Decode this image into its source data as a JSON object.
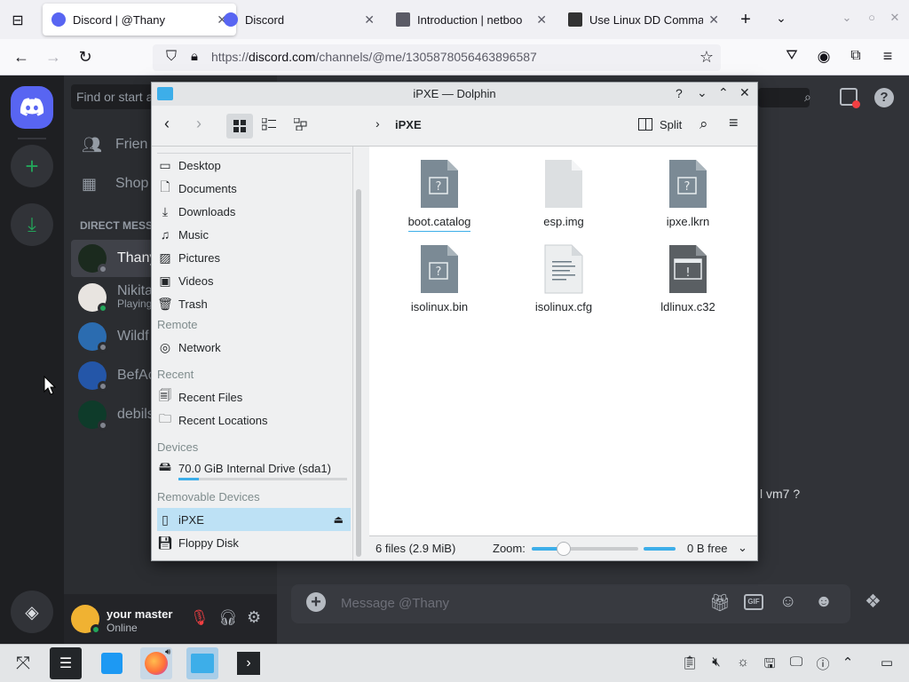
{
  "browser": {
    "tabs": [
      {
        "title": "Discord | @Thany",
        "active": true
      },
      {
        "title": "Discord",
        "active": false
      },
      {
        "title": "Introduction | netboo",
        "active": false
      },
      {
        "title": "Use Linux DD Comma",
        "active": false
      }
    ],
    "url_prefix": "https://",
    "url_domain": "discord.com",
    "url_path": "/channels/@me/1305878056463896587"
  },
  "discord": {
    "search_placeholder": "Find or start a",
    "nav": [
      {
        "label": "Frien",
        "icon": "friends-icon"
      },
      {
        "label": "Shop",
        "icon": "shop-icon"
      }
    ],
    "dm_header": "DIRECT MESS",
    "dms": [
      {
        "name": "Thany",
        "sub": "",
        "selected": true,
        "avatar_color": "#1b2a1e",
        "status": "offline"
      },
      {
        "name": "Nikita",
        "sub": "Playing",
        "selected": false,
        "avatar_color": "#e8e4e0",
        "status": "online"
      },
      {
        "name": "Wildf",
        "sub": "",
        "selected": false,
        "avatar_color": "#2b6cb0",
        "status": "offline"
      },
      {
        "name": "BefAc",
        "sub": "",
        "selected": false,
        "avatar_color": "#2456a8",
        "status": "offline"
      },
      {
        "name": "debils",
        "sub": "",
        "selected": false,
        "avatar_color": "#0e3b2a",
        "status": "offline"
      }
    ],
    "user": {
      "name": "your master",
      "status": "Online"
    },
    "message_placeholder": "Message @Thany",
    "chat_fragment": "l vm7 ?"
  },
  "dolphin": {
    "title": "iPXE — Dolphin",
    "breadcrumb": "iPXE",
    "split_label": "Split",
    "places": {
      "items_top": [
        "Desktop",
        "Documents",
        "Downloads",
        "Music",
        "Pictures",
        "Videos",
        "Trash"
      ],
      "remote_header": "Remote",
      "remote_items": [
        "Network"
      ],
      "recent_header": "Recent",
      "recent_items": [
        "Recent Files",
        "Recent Locations"
      ],
      "devices_header": "Devices",
      "device": "70.0 GiB Internal Drive (sda1)",
      "device_usage": 0.12,
      "removable_header": "Removable Devices",
      "removable_items": [
        "iPXE",
        "Floppy Disk"
      ]
    },
    "files": [
      {
        "name": "boot.catalog",
        "kind": "unknown"
      },
      {
        "name": "esp.img",
        "kind": "blank"
      },
      {
        "name": "ipxe.lkrn",
        "kind": "unknown"
      },
      {
        "name": "isolinux.bin",
        "kind": "unknown"
      },
      {
        "name": "isolinux.cfg",
        "kind": "text"
      },
      {
        "name": "ldlinux.c32",
        "kind": "exec"
      }
    ],
    "status_text": "6 files (2.9 MiB)",
    "zoom_label": "Zoom:",
    "zoom_level": 0.3,
    "free_space": "0 B free"
  }
}
